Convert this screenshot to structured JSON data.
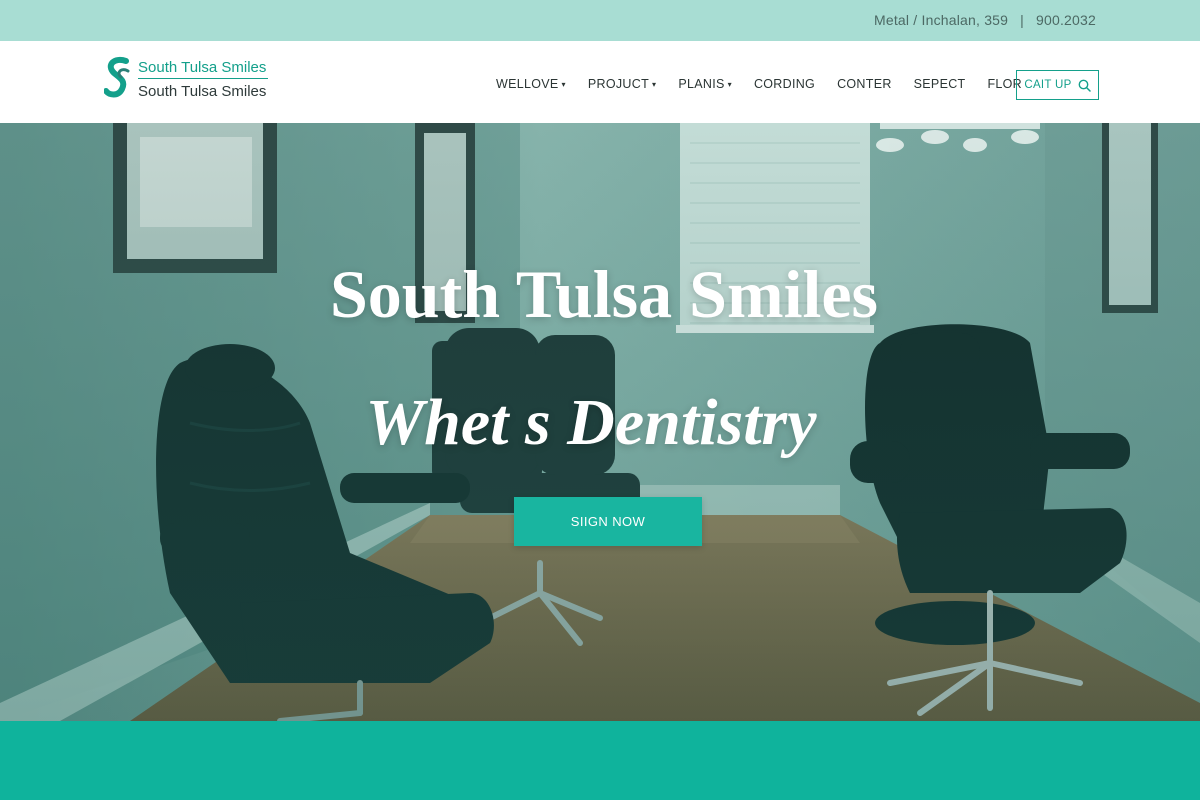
{
  "topbar": {
    "address": "Metal / Inchalan, 359",
    "separator": "|",
    "phone": "900.2032"
  },
  "header": {
    "logo_line1": "South Tulsa Smiles",
    "logo_line2": "South Tulsa Smiles",
    "nav": [
      {
        "label": "WELLOVE",
        "dropdown": true
      },
      {
        "label": "PROJUCT",
        "dropdown": true
      },
      {
        "label": "PLANIS",
        "dropdown": true
      },
      {
        "label": "CORDING",
        "dropdown": false
      },
      {
        "label": "CONTER",
        "dropdown": false
      },
      {
        "label": "SEPECT",
        "dropdown": false
      },
      {
        "label": "FLOR",
        "dropdown": false
      }
    ],
    "cta_label": "CAIT UP",
    "cta_icon": "search-icon"
  },
  "hero": {
    "title": "South Tulsa Smiles",
    "subtitle": "Whet s Dentistry",
    "button_label": "SIIGN NOW"
  },
  "colors": {
    "accent": "#14a08b",
    "topbar_bg": "#a8ddd3",
    "band": "#0fb39c"
  }
}
